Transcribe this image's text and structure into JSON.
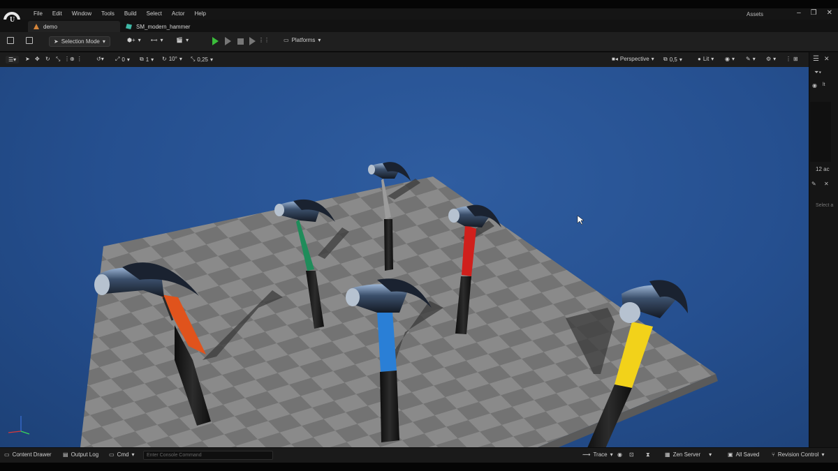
{
  "menu": [
    "File",
    "Edit",
    "Window",
    "Tools",
    "Build",
    "Select",
    "Actor",
    "Help"
  ],
  "assets_label": "Assets",
  "window_controls": [
    "–",
    "❐",
    "✕"
  ],
  "tabs": [
    {
      "label": "demo",
      "icon": "level-icon"
    },
    {
      "label": "SM_modern_hammer",
      "icon": "static-mesh-icon"
    }
  ],
  "toolbar": {
    "selection_mode": "Selection Mode",
    "platforms": "Platforms"
  },
  "viewport_toolbar": {
    "rotate_snap_count": "0",
    "scale_snap_count": "1",
    "angle_snap": "10°",
    "scale_snap": "0,25",
    "perspective": "Perspective",
    "camera_speed": "0,5",
    "view_mode": "Lit"
  },
  "right_panel": {
    "count": "12 ac",
    "select_hint": "Select a"
  },
  "statusbar": {
    "content_drawer": "Content Drawer",
    "output_log": "Output Log",
    "cmd": "Cmd",
    "console_placeholder": "Enter Console Command",
    "trace": "Trace",
    "zen_server": "Zen Server",
    "all_saved": "All Saved",
    "revision_control": "Revision Control"
  },
  "hammers": [
    {
      "handle_color": "#e0531c"
    },
    {
      "handle_color": "#1f8c5a"
    },
    {
      "handle_color": "#9c9c9c"
    },
    {
      "handle_color": "#d0201c"
    },
    {
      "handle_color": "#2a7fd6"
    },
    {
      "handle_color": "#f2d21a"
    }
  ],
  "colors": {
    "sky": "#2a5696",
    "floor_light": "#8a8a8a",
    "floor_dark": "#6e6e6e",
    "play_green": "#3bbd3b"
  }
}
